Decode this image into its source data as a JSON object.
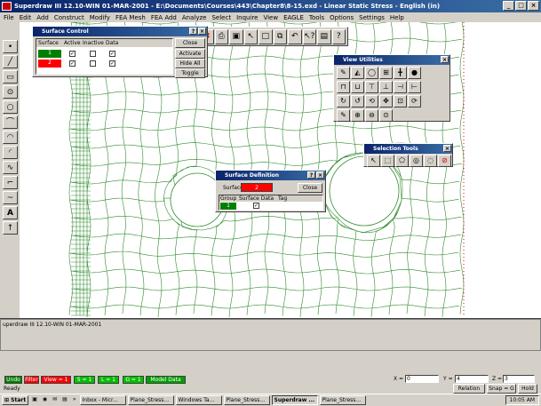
{
  "window": {
    "title": "Superdraw III 12.10-WIN 01-MAR-2001 - E:\\Documents\\Courses\\443\\Chapter8\\8-15.exd - Linear Static Stress - English (in)"
  },
  "menu": [
    "File",
    "Edit",
    "Add",
    "Construct",
    "Modify",
    "FEA Mesh",
    "FEA Add",
    "Analyze",
    "Select",
    "Inquire",
    "View",
    "EAGLE",
    "Tools",
    "Options",
    "Settings",
    "Help"
  ],
  "surface_control": {
    "title": "Surface Control",
    "headers": {
      "surface": "Surface",
      "active": "Active",
      "inactive": "Inactive",
      "data": "Data"
    },
    "rows": [
      {
        "surface": "1",
        "color": "#008000"
      },
      {
        "surface": "2",
        "color": "#ff0000"
      }
    ],
    "buttons": {
      "close": "Close",
      "activate_all": "Activate All",
      "hide_all": "Hide All",
      "toggle": "Toggle"
    }
  },
  "view_utilities": {
    "title": "View Utilities"
  },
  "selection_tools": {
    "title": "Selection Tools"
  },
  "surface_definition": {
    "title": "Surface Definition",
    "surface_label": "Surface:",
    "surface_value": "2",
    "close": "Close",
    "headers": {
      "group": "Group",
      "surface_data": "Surface Data",
      "tag": "Tag"
    },
    "group_value": "1"
  },
  "status_message": "uperdraw III 12.10-WIN 01-MAR-2001",
  "bottom_tags": [
    {
      "label": "Undo",
      "color": "#008000"
    },
    {
      "label": "Filter",
      "color": "#ff0000"
    },
    {
      "label": "View = 1",
      "color": "#ff0000"
    },
    {
      "label": "S = 1",
      "color": "#00c000"
    },
    {
      "label": "L = 1",
      "color": "#00c000"
    },
    {
      "label": "G = 1",
      "color": "#00c000"
    },
    {
      "label": "Model Data",
      "color": "#00a000"
    }
  ],
  "coords": {
    "x_label": "X =",
    "x_value": "0",
    "y_label": "Y =",
    "y_value": "4",
    "z_label": "Z =",
    "z_value": "3"
  },
  "ready": "Ready",
  "snap_buttons": {
    "relation": "Relation",
    "snap": "Snap = G",
    "hold": "Hold"
  },
  "taskbar": {
    "start": "Start",
    "items": [
      "Inbox - Micr...",
      "Plane_Stress...",
      "Windows Ta...",
      "Plane_Stress...",
      "Superdraw ...",
      "Plane_Stress..."
    ],
    "clock": "10:05 AM"
  }
}
